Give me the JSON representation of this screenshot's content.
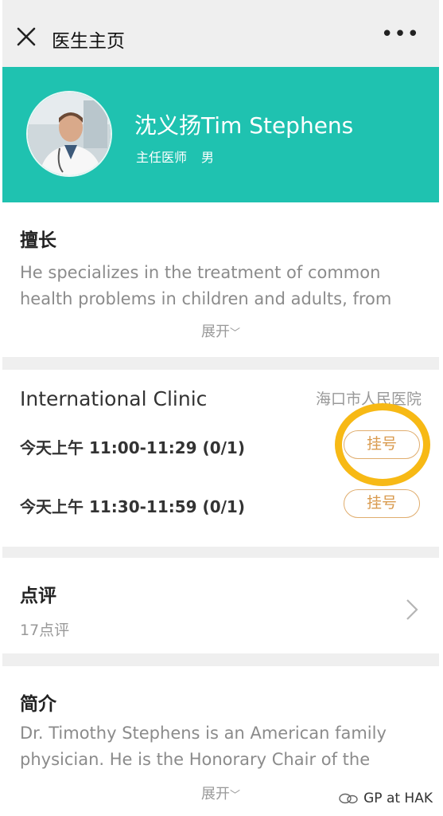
{
  "nav": {
    "title": "医生主页",
    "more_icon": "more-icon",
    "close_icon": "close-icon"
  },
  "doctor": {
    "name": "沈义扬Tim Stephens",
    "title": "主任医师",
    "gender": "男",
    "header_color": "#1fc2b0"
  },
  "specialty": {
    "heading": "擅长",
    "text": "He specializes in the treatment of common health problems in children and adults, from",
    "expand_label": "展开"
  },
  "clinic": {
    "name": "International Clinic",
    "hospital": "海口市人民医院",
    "slots": [
      {
        "time": "今天上午 11:00-11:29 (0/1)",
        "button": "挂号"
      },
      {
        "time": "今天上午 11:30-11:59 (0/1)",
        "button": "挂号"
      }
    ],
    "button_color": "#d99a4e",
    "highlight_color": "#f7b915"
  },
  "reviews": {
    "heading": "点评",
    "count": "17点评"
  },
  "intro": {
    "heading": "简介",
    "text": "Dr. Timothy Stephens is an American family physician. He is the Honorary Chair of the",
    "expand_label": "展开"
  },
  "watermark": {
    "text": "GP at HAK",
    "icon": "wechat-icon"
  }
}
